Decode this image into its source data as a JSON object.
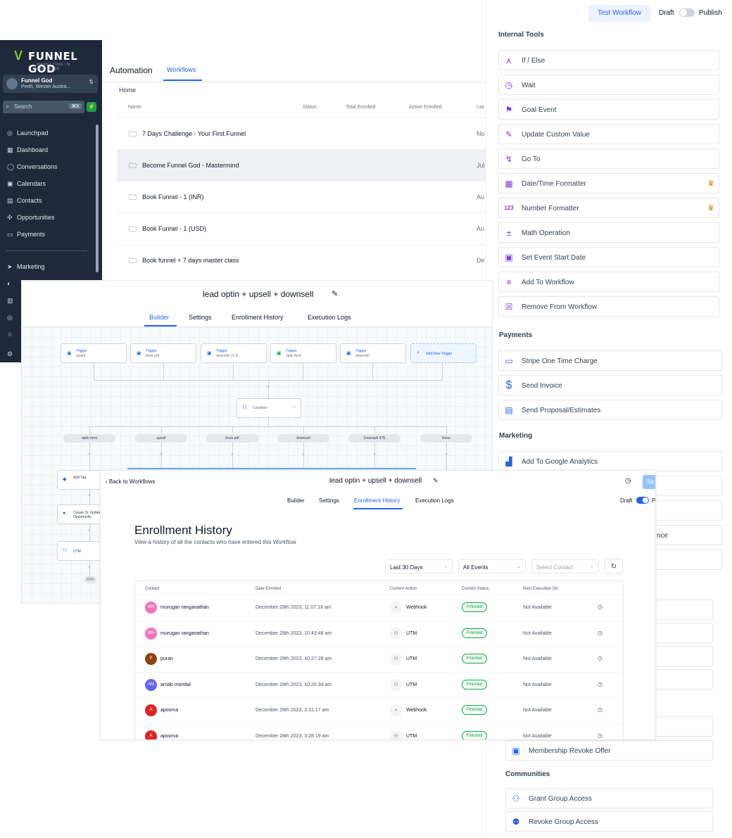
{
  "sidebar": {
    "brand": "FUNNEL GOD",
    "brand_sub": "MARKETING IN GODMODE",
    "account": {
      "name": "Funnel God",
      "location": "Perth, Wester Austra..."
    },
    "search": {
      "placeholder": "Search",
      "shortcut": "⌘K"
    },
    "items": [
      {
        "label": "Launchpad",
        "icon": "rocket-icon"
      },
      {
        "label": "Dashboard",
        "icon": "grid-icon"
      },
      {
        "label": "Conversations",
        "icon": "chat-icon"
      },
      {
        "label": "Calendars",
        "icon": "calendar-icon"
      },
      {
        "label": "Contacts",
        "icon": "contacts-icon"
      },
      {
        "label": "Opportunities",
        "icon": "network-icon"
      },
      {
        "label": "Payments",
        "icon": "card-icon"
      },
      {
        "label": "Marketing",
        "icon": "send-icon"
      }
    ]
  },
  "header": {
    "title": "Automation",
    "tab": "Workflows"
  },
  "breadcrumb": "Home",
  "workflow_table": {
    "columns": [
      "Name",
      "Status",
      "Total Enrolled",
      "Active Enrolled",
      "Las"
    ],
    "rows": [
      {
        "name": "7 Days Challenge - Your First Funnel",
        "last": "No"
      },
      {
        "name": "Become Funnel God - Mastermind",
        "last": "Jul"
      },
      {
        "name": "Book Funnel - 1 (INR)",
        "last": "Au"
      },
      {
        "name": "Book Funnel - 1 (USD)",
        "last": "Au"
      },
      {
        "name": "Book funnel + 7 days master class",
        "last": "De"
      }
    ]
  },
  "right_panel": {
    "test_workflow": "Test Workflow",
    "draft": "Draft",
    "publish": "Publish",
    "sections": {
      "internal_tools": "Internal Tools",
      "payments": "Payments",
      "marketing": "Marketing",
      "communities": "Communities"
    },
    "internal_tools": [
      {
        "label": "If / Else",
        "icon": "branch-icon",
        "premium": false
      },
      {
        "label": "Wait",
        "icon": "clock-icon",
        "premium": false
      },
      {
        "label": "Goal Event",
        "icon": "flag-icon",
        "premium": false
      },
      {
        "label": "Update Custom Value",
        "icon": "edit-icon",
        "premium": false
      },
      {
        "label": "Go To",
        "icon": "goto-icon",
        "premium": false
      },
      {
        "label": "Date/Time Formatter",
        "icon": "calendar-icon",
        "premium": true
      },
      {
        "label": "Number Formatter",
        "icon": "number-icon",
        "premium": true
      },
      {
        "label": "Math Operation",
        "icon": "math-icon",
        "premium": false
      },
      {
        "label": "Set Event Start Date",
        "icon": "event-icon",
        "premium": false
      },
      {
        "label": "Add To Workflow",
        "icon": "add-list-icon",
        "premium": false
      },
      {
        "label": "Remove From Workflow",
        "icon": "remove-list-icon",
        "premium": false
      }
    ],
    "payments": [
      {
        "label": "Stripe One Time Charge",
        "icon": "card-icon"
      },
      {
        "label": "Send Invoice",
        "icon": "dollar-icon"
      },
      {
        "label": "Send Proposal/Estimates",
        "icon": "document-icon"
      }
    ],
    "marketing": [
      {
        "label": "Add To Google Analytics",
        "icon": "analytics-icon"
      },
      {
        "label": "nce",
        "icon": ""
      }
    ],
    "memberships": [
      {
        "label": "Membership Revoke Offer",
        "icon": "membership-icon"
      }
    ],
    "communities": [
      {
        "label": "Grant Group Access",
        "icon": "user-add-icon"
      },
      {
        "label": "Revoke Group Access",
        "icon": "user-remove-icon"
      }
    ]
  },
  "builder": {
    "title": "lead optin + upsell + downsell",
    "tabs": [
      "Builder",
      "Settings",
      "Enrollment History",
      "Execution Logs"
    ],
    "active_tab": "Builder",
    "triggers": [
      {
        "title": "Trigger",
        "sub": "upsell"
      },
      {
        "title": "Trigger",
        "sub": "book pdf"
      },
      {
        "title": "Trigger",
        "sub": "downsell 37 $"
      },
      {
        "title": "Trigger",
        "sub": "optin form"
      },
      {
        "title": "Trigger",
        "sub": "downsell"
      }
    ],
    "add_trigger": "Add New Trigger",
    "condition": "Condition",
    "branches": [
      "optin form",
      "upsell",
      "book pdf",
      "downsell",
      "Downsell 97$",
      "None"
    ],
    "nodes": [
      {
        "label": "Add Tag",
        "icon": "tag-icon"
      },
      {
        "label": "Create Or Update Opportunity",
        "icon": "info-icon"
      },
      {
        "label": "UTM",
        "icon": "user-icon"
      }
    ],
    "end": "END"
  },
  "enrollment": {
    "back": "Back to Workflows",
    "title": "lead optin + upsell + downsell",
    "save": "Sa",
    "tabs": [
      "Builder",
      "Settings",
      "Enrollment History",
      "Execution Logs"
    ],
    "active_tab": "Enrollment History",
    "draft": "Draft",
    "publish": "Pu",
    "heading": "Enrollment History",
    "subheading": "View a history of all the contacts who have entered this Workflow",
    "filters": {
      "range": "Last 30 Days",
      "events": "All Events",
      "contact_placeholder": "Select Contact"
    },
    "columns": [
      "Contact",
      "Date Enrolled",
      "Current Action",
      "Current Status",
      "Next Execution On"
    ],
    "rows": [
      {
        "initials": "MR",
        "color": "#f472b6",
        "name": "murugan ranganathan",
        "date": "December 28th 2023, 11:07:18 am",
        "action": "Webhook",
        "status": "Finished",
        "next": "Not Available"
      },
      {
        "initials": "MR",
        "color": "#f472b6",
        "name": "murugan ranganathan",
        "date": "December 28th 2023, 10:43:48 am",
        "action": "UTM",
        "status": "Finished",
        "next": "Not Available"
      },
      {
        "initials": "P",
        "color": "#92400e",
        "name": "puran",
        "date": "December 28th 2023, 10:27:28 am",
        "action": "UTM",
        "status": "Finished",
        "next": "Not Available"
      },
      {
        "initials": "AM",
        "color": "#6366f1",
        "name": "arnab mondal",
        "date": "December 28th 2023, 10:26:34 am",
        "action": "UTM",
        "status": "Finished",
        "next": "Not Available"
      },
      {
        "initials": "A",
        "color": "#dc2626",
        "name": "apoorva",
        "date": "December 28th 2023, 3:31:17 am",
        "action": "Webhook",
        "status": "Finished",
        "next": "Not Available"
      },
      {
        "initials": "A",
        "color": "#dc2626",
        "name": "apoorva",
        "date": "December 28th 2023, 3:28:19 am",
        "action": "UTM",
        "status": "Finished",
        "next": "Not Available"
      }
    ]
  },
  "colors": {
    "accent": "#2563eb",
    "sidebar": "#1e293b",
    "success": "#16a34a",
    "tool_icon": "#7c3aed"
  }
}
